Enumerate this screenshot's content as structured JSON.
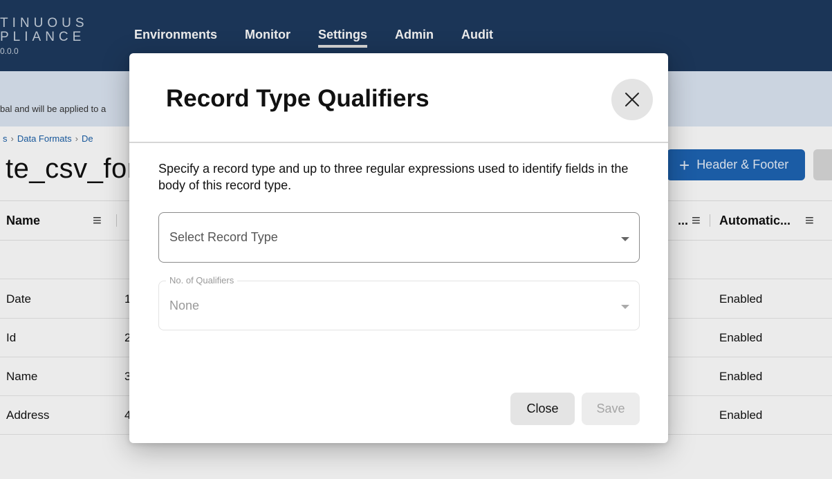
{
  "app": {
    "brand_line1": "TINUOUS",
    "brand_line2": "PLIANCE",
    "version": "0.0.0"
  },
  "nav": {
    "items": [
      {
        "label": "Environments",
        "active": false
      },
      {
        "label": "Monitor",
        "active": false
      },
      {
        "label": "Settings",
        "active": true
      },
      {
        "label": "Admin",
        "active": false
      },
      {
        "label": "Audit",
        "active": false
      }
    ]
  },
  "banner": {
    "text": "bal and will be applied to a"
  },
  "breadcrumb": {
    "item1": "s",
    "item2": "Data Formats",
    "item3": "De"
  },
  "page": {
    "title": "te_csv_for"
  },
  "toolbar": {
    "header_footer_label": "Header & Footer",
    "plus_icon": "plus-icon"
  },
  "table": {
    "headers": {
      "col1": "Name",
      "col_mid": "...",
      "col_last": "Automatic..."
    },
    "rows": [
      {
        "name": "Date",
        "order": "1",
        "status": "Enabled"
      },
      {
        "name": "Id",
        "order": "2",
        "status": "Enabled"
      },
      {
        "name": "Name",
        "order": "3",
        "status": "Enabled"
      },
      {
        "name": "Address",
        "order": "4",
        "status": "Enabled"
      }
    ]
  },
  "modal": {
    "title": "Record Type Qualifiers",
    "description": "Specify a record type and up to three regular expressions used to identify fields in the body of this record type.",
    "record_type": {
      "placeholder": "Select Record Type"
    },
    "qualifiers": {
      "label": "No. of Qualifiers",
      "value": "None"
    },
    "close_label": "Close",
    "save_label": "Save"
  },
  "colors": {
    "topbar": "#1e3a5f",
    "banner": "#dde6f4",
    "accent": "#1e64b4",
    "link": "#1a5fa8"
  }
}
